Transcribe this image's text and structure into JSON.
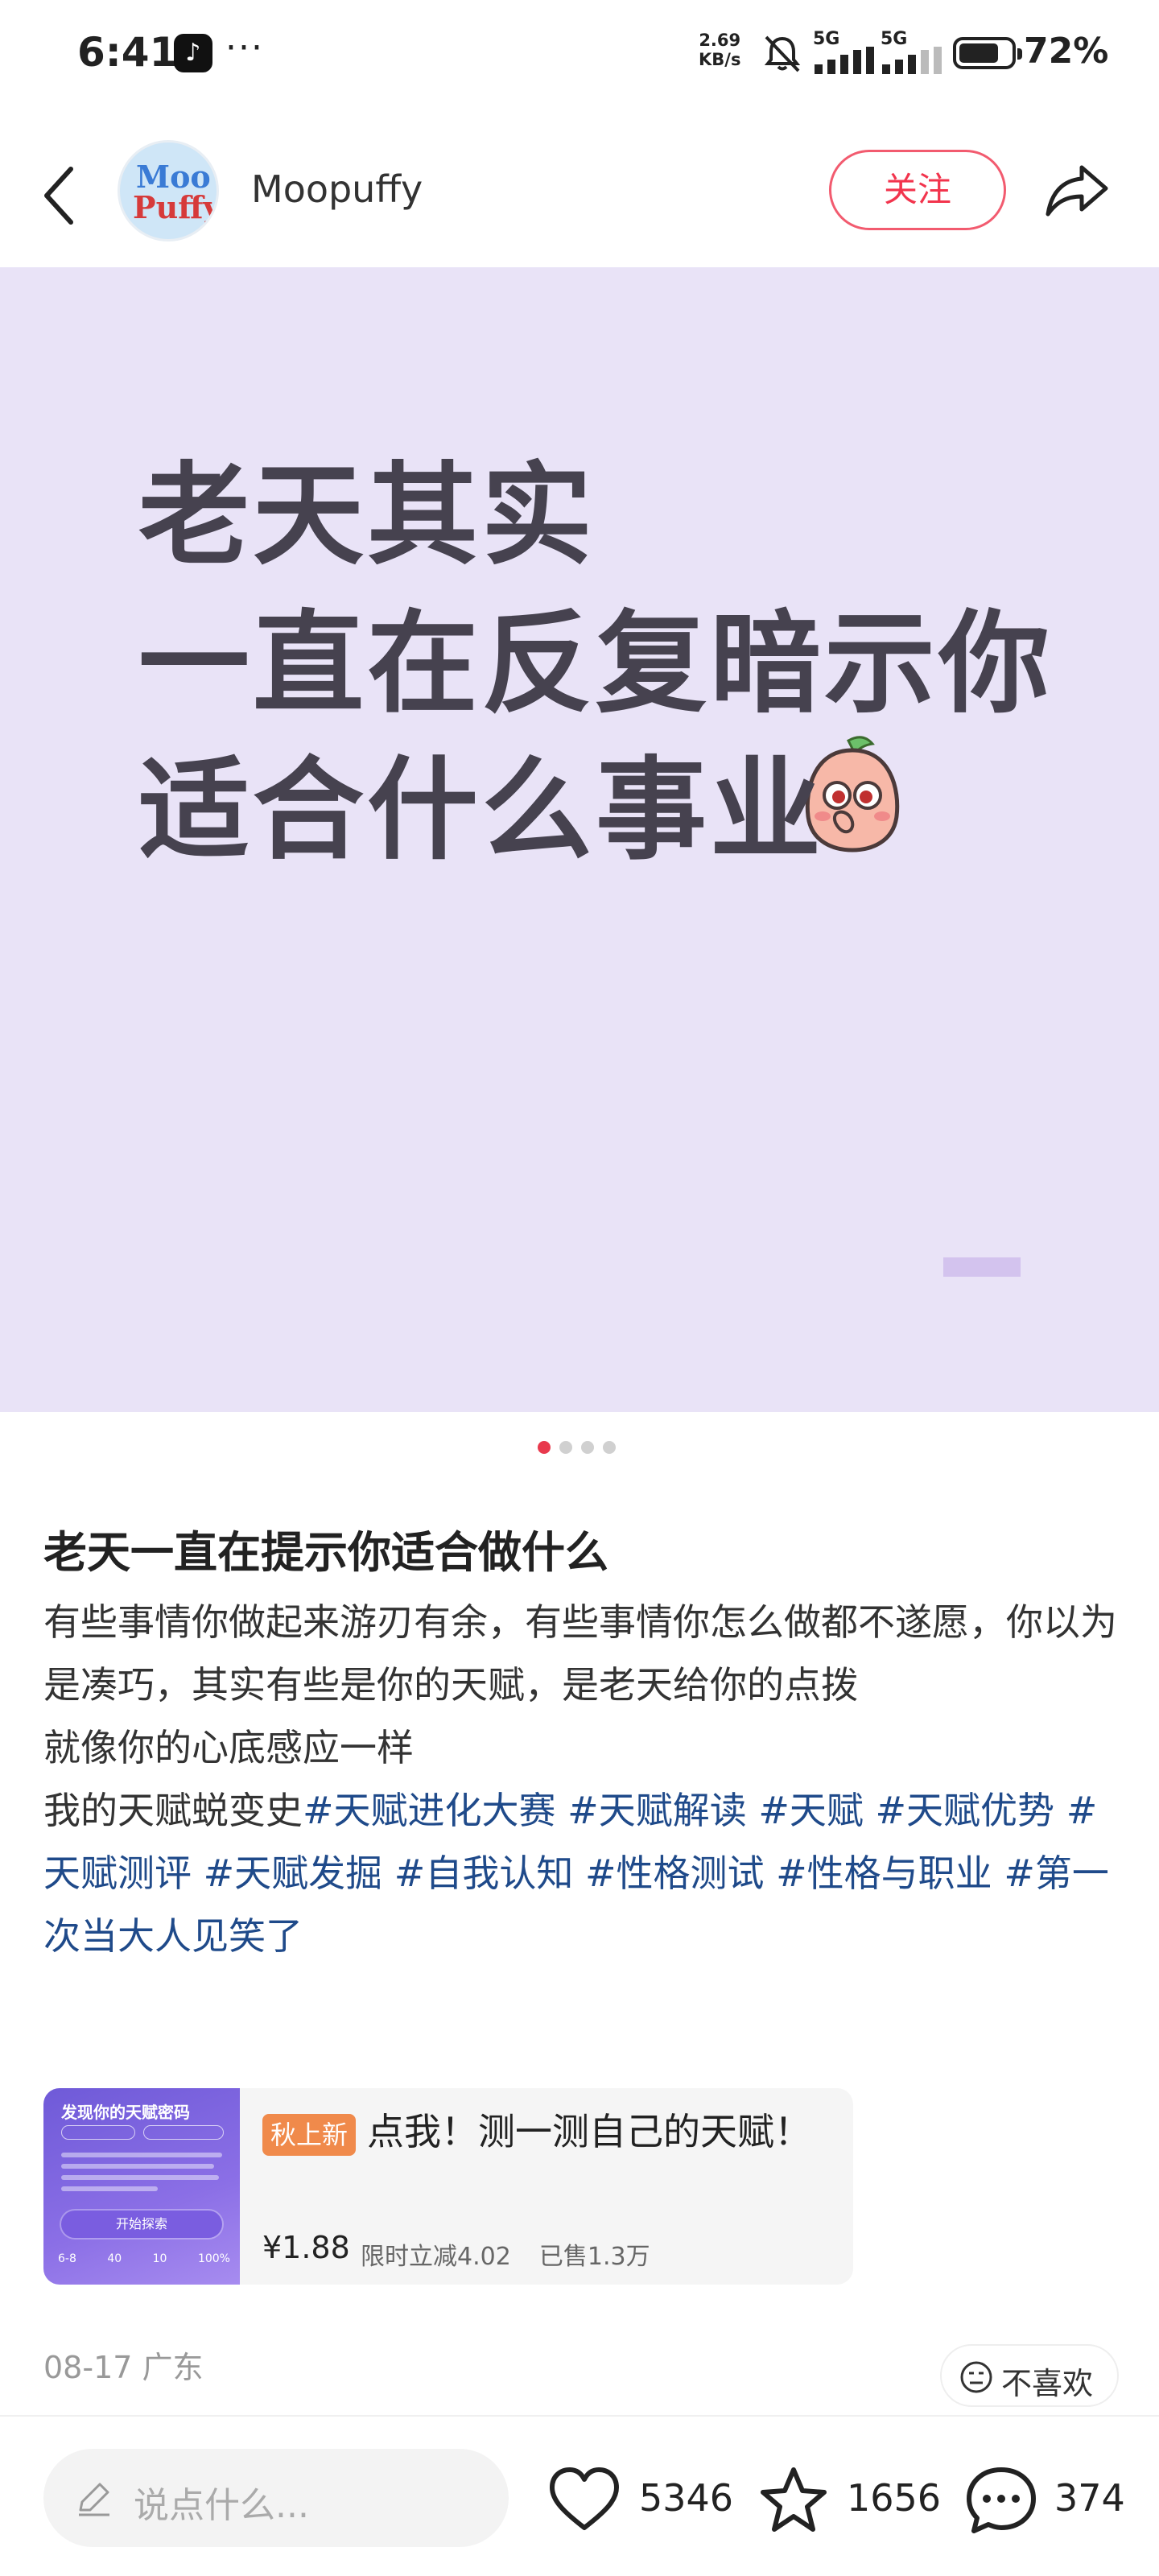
{
  "status_bar": {
    "time": "6:41",
    "more": "···",
    "net_speed_value": "2.69",
    "net_speed_unit": "KB/s",
    "sim1": "5G",
    "sim2": "5G",
    "battery_percent": "72%",
    "battery_level": 0.72
  },
  "header": {
    "avatar_text_1": "Moo",
    "avatar_text_2": "Puffy",
    "username": "Moopuffy",
    "follow_label": "关注",
    "icons": [
      "back-icon",
      "share-icon"
    ]
  },
  "hero": {
    "line1": "老天其实",
    "line2": "一直在反复暗示你",
    "line3_prefix": "适合什么",
    "line3_highlight": "事业",
    "highlight_color": "#b6ef6d",
    "background_color": "#e9e3f7"
  },
  "carousel": {
    "count": 4,
    "active_index": 0,
    "active_color": "#e8394d"
  },
  "post": {
    "title": "老天一直在提示你适合做什么",
    "paragraph1": "有些事情你做起来游刃有余，有些事情你怎么做都不遂愿，你以为是凑巧，其实有些是你的天赋，是老天给你的点拨",
    "paragraph2": "就像你的心底感应一样",
    "paragraph3_prefix": "我的天赋蜕变史",
    "tags": [
      "#天赋进化大赛",
      "#天赋解读",
      "#天赋",
      "#天赋优势",
      "#天赋测评",
      "#天赋发掘",
      "#自我认知",
      "#性格测试",
      "#性格与职业",
      "#第一次当大人见笑了"
    ]
  },
  "product": {
    "thumb_title": "发现你的天赋密码",
    "thumb_button": "开始探索",
    "thumb_stats": [
      "6-8",
      "40",
      "10",
      "100%"
    ],
    "badge": "秋上新",
    "name": "点我！测一测自己的天赋！",
    "price": "¥1.88",
    "discount": "限时立减4.02",
    "sold": "已售1.3万"
  },
  "meta": {
    "date_location": "08-17 广东",
    "dislike_label": "不喜欢"
  },
  "bottom_bar": {
    "comment_placeholder": "说点什么...",
    "likes": "5346",
    "favorites": "1656",
    "comments": "374"
  }
}
